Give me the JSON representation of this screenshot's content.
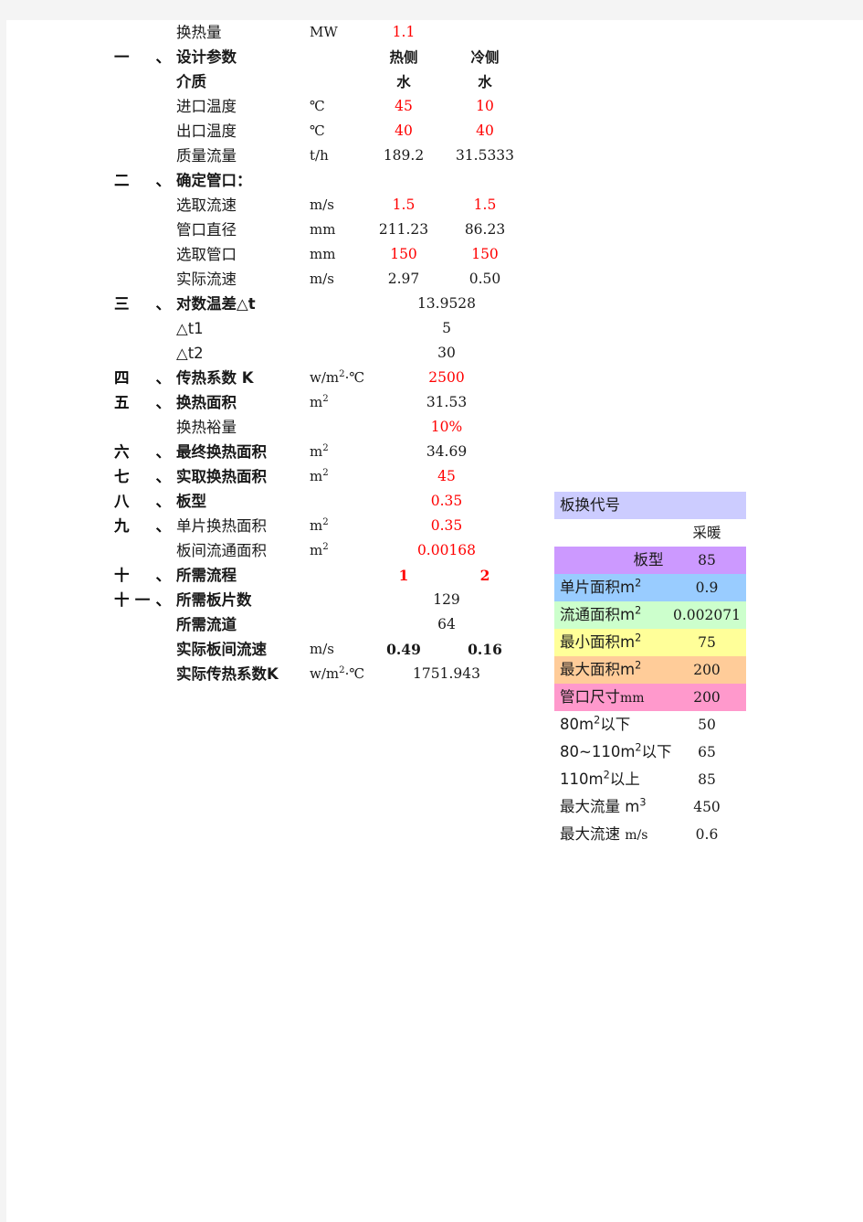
{
  "sheet": {
    "columns": {
      "hot": "热侧",
      "cold": "冷侧"
    },
    "rows": [
      {
        "num": "",
        "label": "换热量",
        "unit": "MW",
        "v1": "1.1",
        "v2": "",
        "v1_red": true,
        "v2_red": false,
        "bold": false,
        "wide": false
      },
      {
        "num": "一、",
        "label": "设计参数",
        "unit": "",
        "v1": "热侧",
        "v2": "冷侧",
        "v1_red": false,
        "v2_red": false,
        "bold": true,
        "wide": false
      },
      {
        "num": "",
        "label": "介质",
        "unit": "",
        "v1": "水",
        "v2": "水",
        "v1_red": false,
        "v2_red": false,
        "bold": true,
        "wide": false
      },
      {
        "num": "",
        "label": "进口温度",
        "unit": "℃",
        "v1": "45",
        "v2": "10",
        "v1_red": true,
        "v2_red": true,
        "bold": false,
        "wide": false
      },
      {
        "num": "",
        "label": "出口温度",
        "unit": "℃",
        "v1": "40",
        "v2": "40",
        "v1_red": true,
        "v2_red": true,
        "bold": false,
        "wide": false
      },
      {
        "num": "",
        "label": "质量流量",
        "unit": "t/h",
        "v1": "189.2",
        "v2": "31.5333",
        "v1_red": false,
        "v2_red": false,
        "bold": false,
        "wide": false
      },
      {
        "num": "二、",
        "label": "确定管口：",
        "unit": "",
        "v1": "",
        "v2": "",
        "v1_red": false,
        "v2_red": false,
        "bold": true,
        "wide": false
      },
      {
        "num": "",
        "label": "选取流速",
        "unit": "m/s",
        "v1": "1.5",
        "v2": "1.5",
        "v1_red": true,
        "v2_red": true,
        "bold": false,
        "wide": false
      },
      {
        "num": "",
        "label": "管口直径",
        "unit": "mm",
        "v1": "211.23",
        "v2": "86.23",
        "v1_red": false,
        "v2_red": false,
        "bold": false,
        "wide": false
      },
      {
        "num": "",
        "label": "选取管口",
        "unit": "mm",
        "v1": "150",
        "v2": "150",
        "v1_red": true,
        "v2_red": true,
        "bold": false,
        "wide": false
      },
      {
        "num": "",
        "label": "实际流速",
        "unit": "m/s",
        "v1": "2.97",
        "v2": "0.50",
        "v1_red": false,
        "v2_red": false,
        "bold": false,
        "wide": false
      },
      {
        "num": "三、",
        "label": "对数温差△t",
        "unit": "",
        "v1": "13.9528",
        "v2": "",
        "v1_red": false,
        "v2_red": false,
        "bold": true,
        "wide": true
      },
      {
        "num": "",
        "label": "△t1",
        "unit": "",
        "v1": "5",
        "v2": "",
        "v1_red": false,
        "v2_red": false,
        "bold": false,
        "wide": true
      },
      {
        "num": "",
        "label": "△t2",
        "unit": "",
        "v1": "30",
        "v2": "",
        "v1_red": false,
        "v2_red": false,
        "bold": false,
        "wide": true
      },
      {
        "num": "四、",
        "label": "传热系数 K",
        "unit": "w/m2·℃",
        "v1": "2500",
        "v2": "",
        "v1_red": true,
        "v2_red": false,
        "bold": true,
        "wide": true
      },
      {
        "num": "五、",
        "label": "换热面积",
        "unit": "m2",
        "v1": "31.53",
        "v2": "",
        "v1_red": false,
        "v2_red": false,
        "bold": true,
        "wide": true
      },
      {
        "num": "",
        "label": "换热裕量",
        "unit": "",
        "v1": "10%",
        "v2": "",
        "v1_red": true,
        "v2_red": false,
        "bold": false,
        "wide": true
      },
      {
        "num": "六、",
        "label": "最终换热面积",
        "unit": "m2",
        "v1": "34.69",
        "v2": "",
        "v1_red": false,
        "v2_red": false,
        "bold": true,
        "wide": true
      },
      {
        "num": "七、",
        "label": "实取换热面积",
        "unit": "m2",
        "v1": "45",
        "v2": "",
        "v1_red": true,
        "v2_red": false,
        "bold": true,
        "wide": true
      },
      {
        "num": "八、",
        "label": "板型",
        "unit": "",
        "v1": "0.35",
        "v2": "",
        "v1_red": true,
        "v2_red": false,
        "bold": true,
        "wide": true
      },
      {
        "num": "九、",
        "label": "单片换热面积",
        "unit": "m2",
        "v1": "0.35",
        "v2": "",
        "v1_red": true,
        "v2_red": false,
        "bold": false,
        "wide": true
      },
      {
        "num": "",
        "label": "板间流通面积",
        "unit": "m2",
        "v1": "0.00168",
        "v2": "",
        "v1_red": true,
        "v2_red": false,
        "bold": false,
        "wide": true
      },
      {
        "num": "十、",
        "label": "所需流程",
        "unit": "",
        "v1": "1",
        "v2": "2",
        "v1_red": true,
        "v2_red": true,
        "bold": true,
        "wide": false
      },
      {
        "num": "十一、",
        "label": "所需板片数",
        "unit": "",
        "v1": "129",
        "v2": "",
        "v1_red": false,
        "v2_red": false,
        "bold": true,
        "wide": true
      },
      {
        "num": "",
        "label": "所需流道",
        "unit": "",
        "v1": "64",
        "v2": "",
        "v1_red": false,
        "v2_red": false,
        "bold": true,
        "wide": true
      },
      {
        "num": "",
        "label": "实际板间流速",
        "unit": "m/s",
        "v1": "0.49",
        "v2": "0.16",
        "v1_red": false,
        "v2_red": false,
        "bold": true,
        "wide": false
      },
      {
        "num": "",
        "label": "实际传热系数K",
        "unit": "w/m2·℃",
        "v1": "1751.943",
        "v2": "",
        "v1_red": false,
        "v2_red": false,
        "bold": true,
        "wide": true
      }
    ]
  },
  "ref": {
    "header": "板换代号",
    "column_header": "采暖",
    "rows": [
      {
        "label": "板型",
        "sup": "",
        "suffix": "",
        "value": "85",
        "color": "c-violet",
        "centered": true,
        "red": false
      },
      {
        "label": "单片面积m",
        "sup": "2",
        "suffix": "",
        "value": "0.9",
        "color": "c-blue",
        "centered": false,
        "red": false
      },
      {
        "label": "流通面积m",
        "sup": "2",
        "suffix": "",
        "value": "0.002071",
        "color": "c-green",
        "centered": false,
        "red": false
      },
      {
        "label": "最小面积m",
        "sup": "2",
        "suffix": "",
        "value": "75",
        "color": "c-yellow",
        "centered": false,
        "red": false
      },
      {
        "label": "最大面积m",
        "sup": "2",
        "suffix": "",
        "value": "200",
        "color": "c-orange",
        "centered": false,
        "red": false
      },
      {
        "label": "管口尺寸",
        "sup": "",
        "suffix": "mm",
        "value": "200",
        "color": "c-pink",
        "centered": false,
        "red": false
      },
      {
        "label": "80m",
        "sup": "2",
        "suffix": "以下",
        "value": "50",
        "color": "",
        "centered": false,
        "red": true
      },
      {
        "label": "80~110m",
        "sup": "2",
        "suffix": "以下",
        "value": "65",
        "color": "",
        "centered": false,
        "red": true
      },
      {
        "label": "110m",
        "sup": "2",
        "suffix": "以上",
        "value": "85",
        "color": "",
        "centered": false,
        "red": true
      },
      {
        "label": "最大流量  m",
        "sup": "3",
        "suffix": "",
        "value": "450",
        "color": "",
        "centered": false,
        "red": false
      },
      {
        "label": "最大流速  m/s",
        "sup": "",
        "suffix": "",
        "value": "0.6",
        "color": "",
        "centered": false,
        "red": false
      }
    ]
  }
}
